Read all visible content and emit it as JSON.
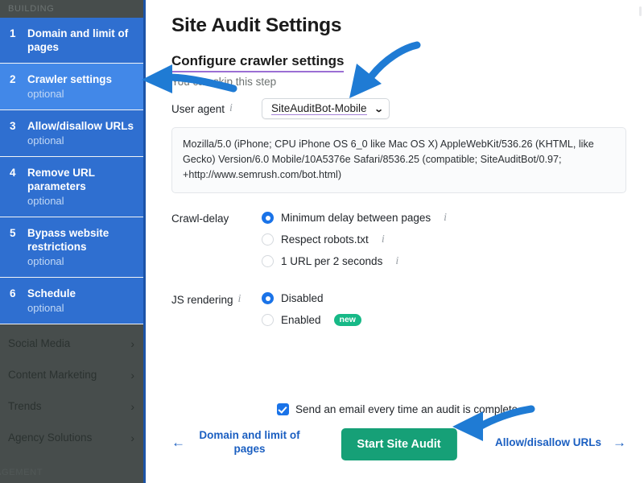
{
  "sidebar": {
    "section_label": "BUILDING",
    "steps": [
      {
        "num": "1",
        "title": "Domain and limit of pages",
        "optional": "",
        "active": false
      },
      {
        "num": "2",
        "title": "Crawler settings",
        "optional": "optional",
        "active": true
      },
      {
        "num": "3",
        "title": "Allow/disallow URLs",
        "optional": "optional",
        "active": false
      },
      {
        "num": "4",
        "title": "Remove URL parameters",
        "optional": "optional",
        "active": false
      },
      {
        "num": "5",
        "title": "Bypass website restrictions",
        "optional": "optional",
        "active": false
      },
      {
        "num": "6",
        "title": "Schedule",
        "optional": "optional",
        "active": false
      }
    ],
    "links": [
      {
        "label": "Social Media",
        "icon": "chevron-right-icon"
      },
      {
        "label": "Content Marketing",
        "icon": "chevron-right-icon"
      },
      {
        "label": "Trends",
        "icon": "chevron-right-icon"
      },
      {
        "label": "Agency Solutions",
        "icon": "chevron-right-icon"
      }
    ],
    "bottom_label": "AGEMENT"
  },
  "main": {
    "page_title": "Site Audit Settings",
    "section_heading": "Configure crawler settings",
    "section_sub": "You can skip this step",
    "user_agent": {
      "label": "User agent",
      "info_icon": "info-icon",
      "selected": "SiteAuditBot-Mobile",
      "caret_icon": "chevron-down-icon",
      "options": [
        "SiteAuditBot-Mobile"
      ],
      "string": "Mozilla/5.0 (iPhone; CPU iPhone OS 6_0 like Mac OS X) AppleWebKit/536.26 (KHTML, like Gecko) Version/6.0 Mobile/10A5376e Safari/8536.25 (compatible; SiteAuditBot/0.97; +http://www.semrush.com/bot.html)"
    },
    "crawl_delay": {
      "label": "Crawl-delay",
      "options": [
        {
          "text": "Minimum delay between pages",
          "selected": true,
          "info": "info-icon"
        },
        {
          "text": "Respect robots.txt",
          "selected": false,
          "info": "info-icon"
        },
        {
          "text": "1 URL per 2 seconds",
          "selected": false,
          "info": "info-icon"
        }
      ]
    },
    "js_rendering": {
      "label": "JS rendering",
      "info_icon": "info-icon",
      "options": [
        {
          "text": "Disabled",
          "selected": true,
          "badge": ""
        },
        {
          "text": "Enabled",
          "selected": false,
          "badge": "new"
        }
      ]
    }
  },
  "footer": {
    "email_checkbox_label": "Send an email every time an audit is complete.",
    "email_checked": true,
    "prev_arrow": "arrow-left-icon",
    "prev_label": "Domain and limit of pages",
    "cta_label": "Start Site Audit",
    "next_label": "Allow/disallow URLs",
    "next_arrow": "arrow-right-icon"
  },
  "colors": {
    "sidebar_bg": "#474d4c",
    "step_bg": "#2f6fd0",
    "step_active_bg": "#4288e8",
    "accent_underline": "#9b6fd4",
    "radio_blue": "#1a73e8",
    "cta_green": "#16a077",
    "badge_green": "#17b987",
    "link_blue": "#1b5fc1",
    "annotation_blue": "#1f7bd4"
  }
}
